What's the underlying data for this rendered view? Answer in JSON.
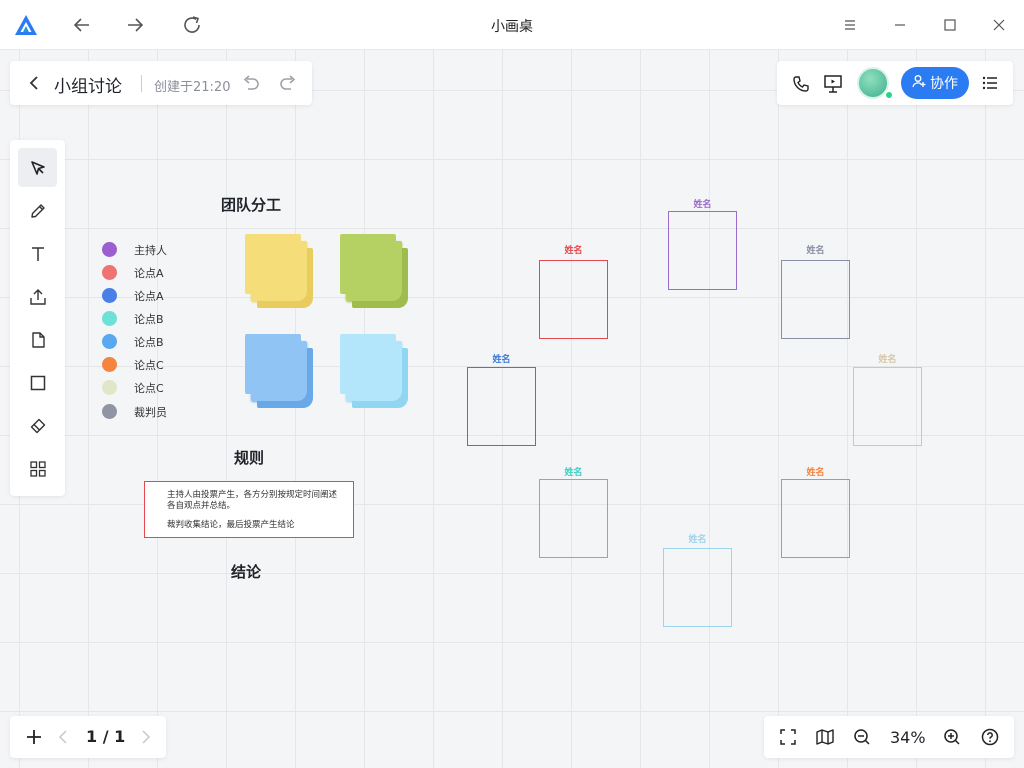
{
  "window": {
    "title": "小画桌"
  },
  "doc": {
    "title": "小组讨论",
    "created": "创建于21:20"
  },
  "header": {
    "collab_label": "协作"
  },
  "pager": {
    "page": "1 / 1"
  },
  "zoom": {
    "value": "34%"
  },
  "board": {
    "team_heading": "团队分工",
    "rules_heading": "规则",
    "conclusion_heading": "结论",
    "legend": [
      {
        "label": "主持人",
        "color": "#9b5fcf"
      },
      {
        "label": "论点A",
        "color": "#f07373"
      },
      {
        "label": "论点A",
        "color": "#4a7fe8"
      },
      {
        "label": "论点B",
        "color": "#6ee0d8"
      },
      {
        "label": "论点B",
        "color": "#58a8f0"
      },
      {
        "label": "论点C",
        "color": "#f5843e"
      },
      {
        "label": "论点C",
        "color": "#e2e6c8"
      },
      {
        "label": "裁判员",
        "color": "#8f95a3"
      }
    ],
    "stickies": [
      {
        "color": "#f5dd7a",
        "shade": "#e8cc5e"
      },
      {
        "color": "#b5d164",
        "shade": "#9fbd4c"
      },
      {
        "color": "#8fc4f5",
        "shade": "#6aa9e8"
      },
      {
        "color": "#b3e6fb",
        "shade": "#90d5f2"
      }
    ],
    "rules_line1": "主持人由投票产生，各方分别按规定时间阐述",
    "rules_line2": "各自观点并总结。",
    "rules_line3": "裁判收集结论，最后投票产生结论",
    "name_boxes": [
      {
        "label": "姓名",
        "color": "#9b6bc9"
      },
      {
        "label": "姓名",
        "color": "#e5484d"
      },
      {
        "label": "姓名",
        "color": "#8a8fa3"
      },
      {
        "label": "姓名",
        "color": "#3b7bd9"
      },
      {
        "label": "姓名",
        "color": "#d8c6a8"
      },
      {
        "label": "姓名",
        "color": "#3fcfc2"
      },
      {
        "label": "姓名",
        "color": "#f5843e"
      },
      {
        "label": "姓名",
        "color": "#9ed3ee"
      }
    ]
  }
}
